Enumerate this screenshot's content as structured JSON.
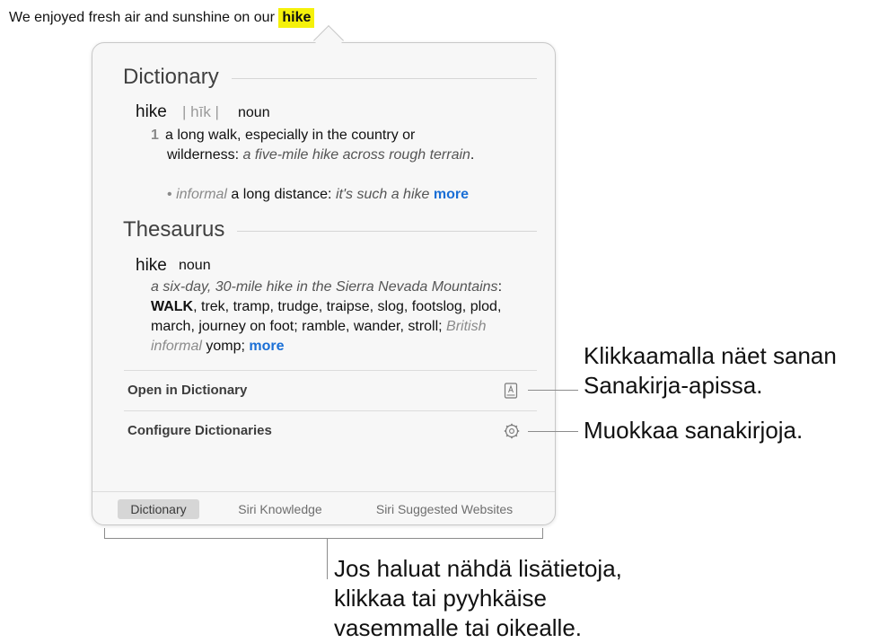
{
  "sentence": {
    "before": "We enjoyed fresh air and sunshine on our ",
    "highlight": "hike"
  },
  "dictionary": {
    "title": "Dictionary",
    "headword": "hike",
    "pronunciation": "| hīk |",
    "pos": "noun",
    "def_num": "1",
    "def_text": "a long walk, especially in the country or wilderness:",
    "def_example": "a five-mile hike across rough terrain",
    "def_end": ".",
    "sub_bullet": "•",
    "sub_register": "informal",
    "sub_text": "a long distance:",
    "sub_example": "it's such a hike",
    "more": "more"
  },
  "thesaurus": {
    "title": "Thesaurus",
    "headword": "hike",
    "pos": "noun",
    "example": "a six-day, 30-mile hike in the Sierra Nevada Mountains",
    "colon": ": ",
    "main_syn": "WALK",
    "syns": ", trek, tramp, trudge, traipse, slog, footslog, plod, march, journey on foot; ramble, wander, stroll; ",
    "register": "British informal",
    "last_syn": " yomp; ",
    "more": "more"
  },
  "actions": {
    "open_dictionary": "Open in Dictionary",
    "configure": "Configure Dictionaries"
  },
  "tabs": [
    "Dictionary",
    "Siri Knowledge",
    "Siri Suggested Websites"
  ],
  "callouts": {
    "open": [
      "Klikkaamalla näet sanan",
      "Sanakirja-apissa."
    ],
    "configure": "Muokkaa sanakirjoja.",
    "swipe": [
      "Jos haluat nähdä lisätietoja,",
      "klikkaa tai pyyhkäise",
      "vasemmalle tai oikealle."
    ]
  },
  "colors": {
    "highlight": "#f5f10a",
    "link": "#1a6fd6",
    "popover_bg": "#f7f7f7"
  },
  "icons": {
    "open": "book-icon",
    "configure": "gear-icon"
  }
}
